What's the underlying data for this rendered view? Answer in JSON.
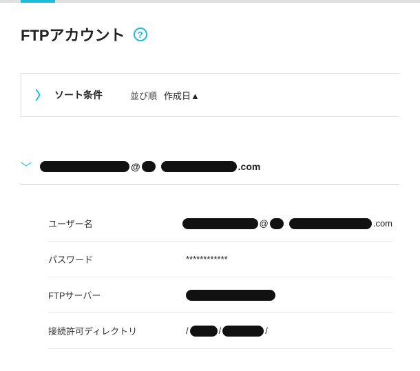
{
  "page": {
    "title": "FTPアカウント"
  },
  "sort": {
    "label": "ソート条件",
    "order_label": "並び順",
    "value": "作成日▲"
  },
  "account": {
    "header_at": "@",
    "header_suffix": ".com",
    "fields": {
      "username_label": "ユーザー名",
      "username_at": "@",
      "username_suffix": ".com",
      "password_label": "パスワード",
      "password_value": "************",
      "server_label": "FTPサーバー",
      "dir_label": "接続許可ディレクトリ",
      "dir_slash1": "/",
      "dir_slash2": "/",
      "dir_slash3": "/"
    }
  }
}
